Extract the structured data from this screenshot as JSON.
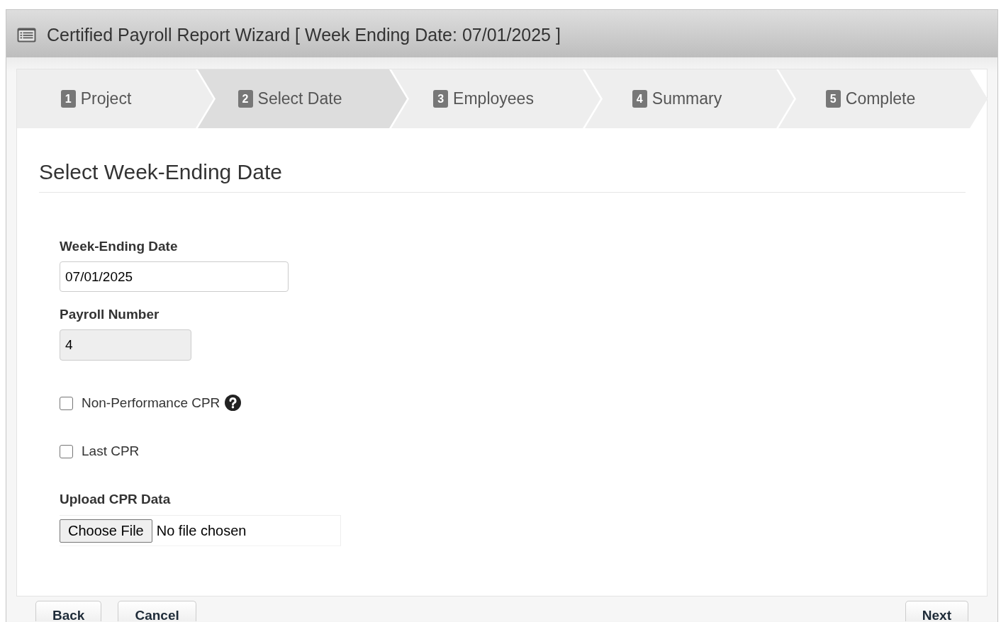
{
  "window": {
    "title": "Certified Payroll Report Wizard [ Week Ending Date: 07/01/2025 ]"
  },
  "steps": [
    {
      "number": "1",
      "label": "Project",
      "selected": false
    },
    {
      "number": "2",
      "label": "Select Date",
      "selected": true
    },
    {
      "number": "3",
      "label": "Employees",
      "selected": false
    },
    {
      "number": "4",
      "label": "Summary",
      "selected": false
    },
    {
      "number": "5",
      "label": "Complete",
      "selected": false
    }
  ],
  "section": {
    "title": "Select Week-Ending Date"
  },
  "fields": [
    {
      "kind": "date",
      "label": "Week-Ending Date",
      "value": "07/01/2025",
      "disabled": false
    },
    {
      "kind": "number",
      "label": "Payroll Number",
      "value": "4",
      "disabled": true
    },
    {
      "kind": "checkbox",
      "label": "Non-Performance CPR",
      "checked": false,
      "help": true
    },
    {
      "kind": "checkbox",
      "label": "Last CPR",
      "checked": false,
      "help": false
    },
    {
      "kind": "file",
      "label": "Upload CPR Data",
      "button": "Choose File",
      "status": "No file chosen"
    }
  ],
  "footer": {
    "left_buttons": [
      "Back",
      "Cancel"
    ],
    "right_buttons": [
      "Next"
    ]
  }
}
